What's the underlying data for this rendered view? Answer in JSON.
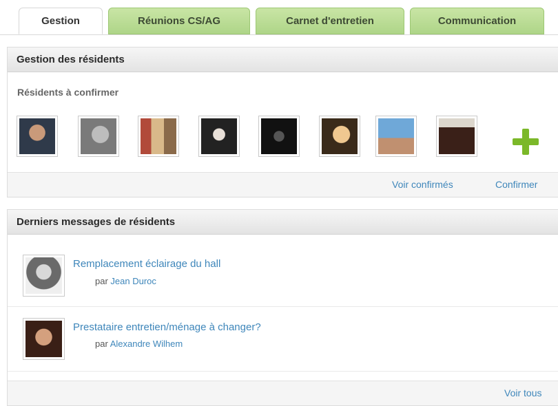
{
  "tabs": [
    {
      "label": "Gestion",
      "active": true
    },
    {
      "label": "Réunions CS/AG",
      "active": false
    },
    {
      "label": "Carnet d'entretien",
      "active": false
    },
    {
      "label": "Communication",
      "active": false
    }
  ],
  "residents_panel": {
    "title": "Gestion des résidents",
    "subtitle": "Résidents à confirmer",
    "avatars_count": 8,
    "add_icon": "plus-icon",
    "view_confirmed_label": "Voir confirmés",
    "confirm_label": "Confirmer"
  },
  "messages_panel": {
    "title": "Derniers messages de résidents",
    "by_prefix": "par",
    "messages": [
      {
        "title": "Remplacement éclairage du hall",
        "author": "Jean Duroc"
      },
      {
        "title": "Prestataire entretien/ménage à changer?",
        "author": "Alexandre Wilhem"
      }
    ],
    "view_all_label": "Voir tous"
  },
  "colors": {
    "accent_link": "#3e86ba",
    "tab_green": "#aed588",
    "plus_green": "#7bb829"
  }
}
